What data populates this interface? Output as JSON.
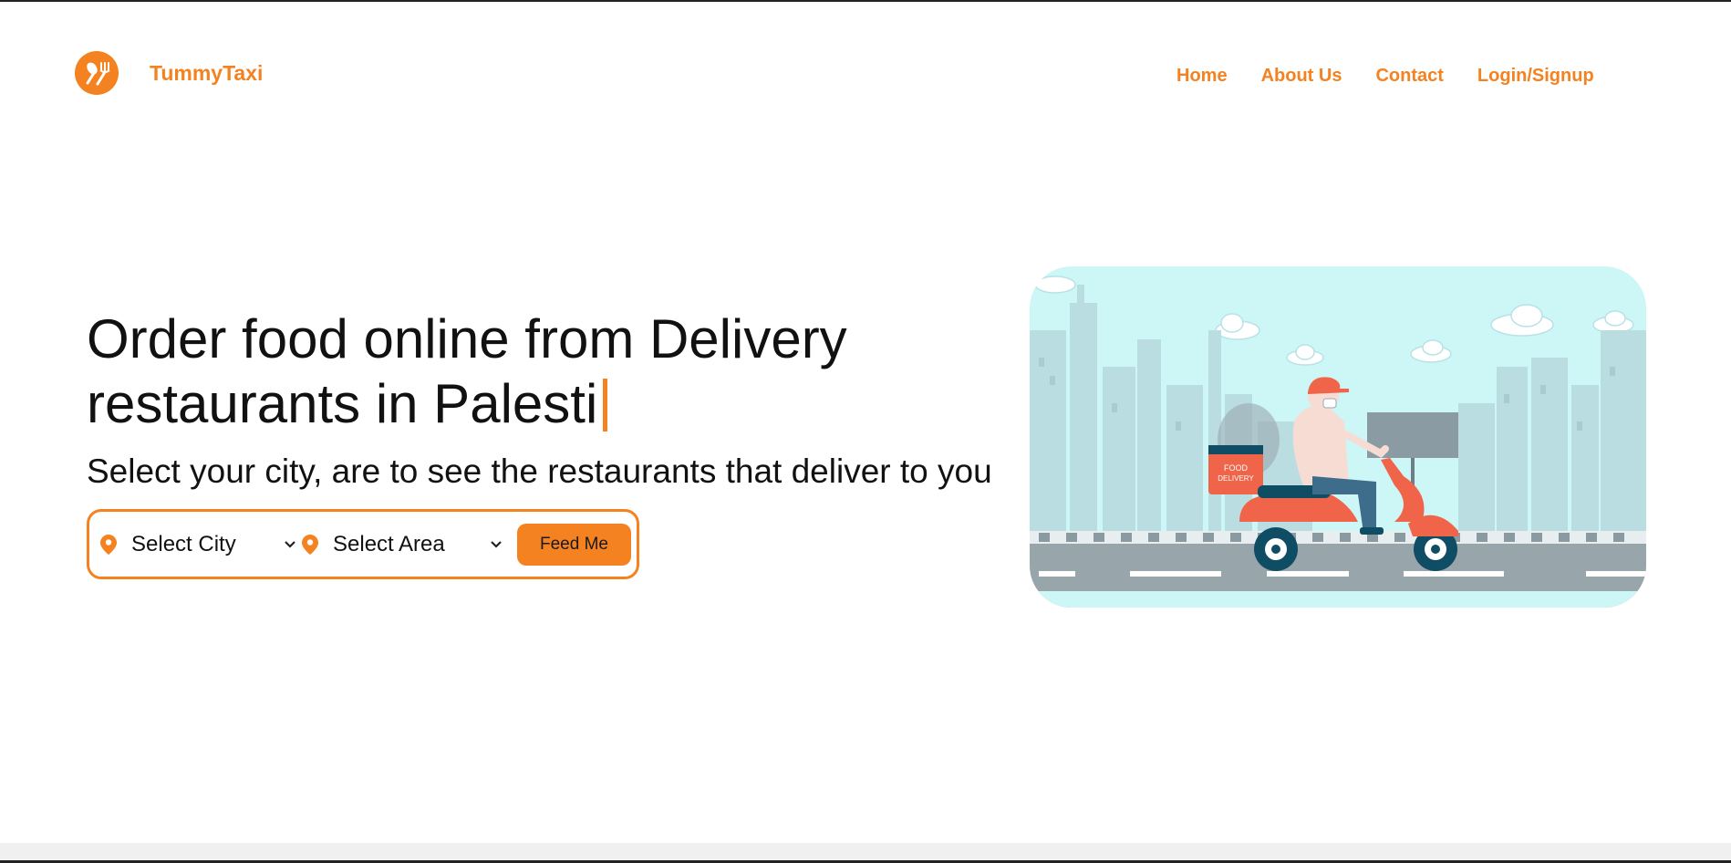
{
  "header": {
    "brand": "TummyTaxi",
    "logo_icon": "spoon-fork-icon",
    "nav": [
      {
        "label": "Home"
      },
      {
        "label": "About Us"
      },
      {
        "label": "Contact"
      },
      {
        "label": "Login/Signup"
      }
    ]
  },
  "hero": {
    "headline_line1": "Order food online from Delivery",
    "headline_line2": "restaurants in Palesti",
    "subline": "Select your city, are to see the restaurants that deliver to you",
    "city_select": "Select City",
    "area_select": "Select Area",
    "feed_button": "Feed Me",
    "illustration_text_1": "FOOD",
    "illustration_text_2": "DELIVERY"
  },
  "colors": {
    "accent": "#f58220",
    "sky": "#cdf6f7",
    "scooter": "#f0644a"
  }
}
